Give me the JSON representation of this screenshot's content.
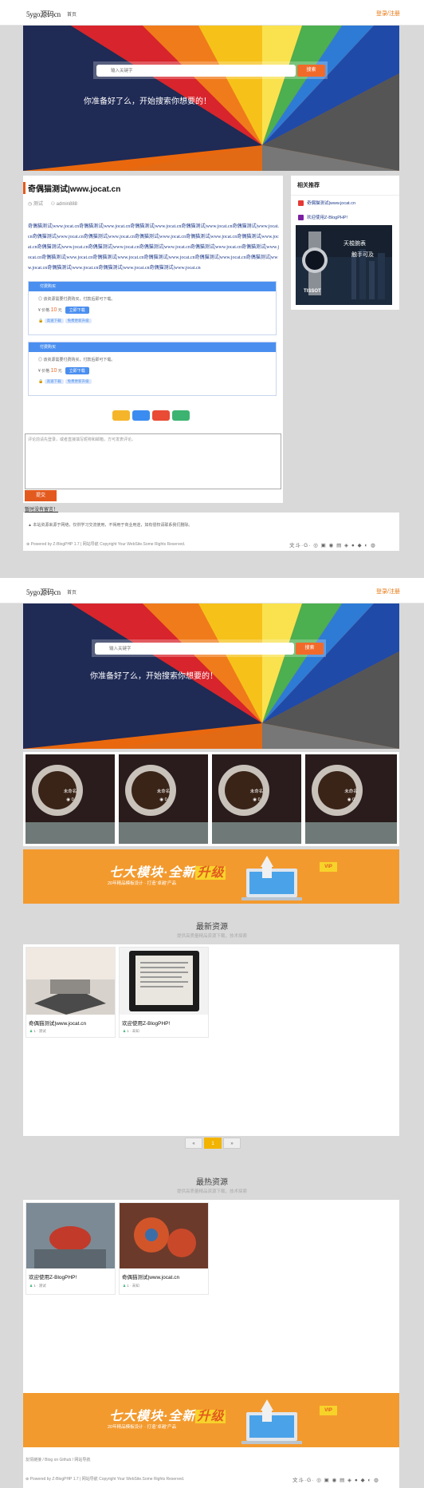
{
  "header": {
    "logo": "5ygo源码cn",
    "nav_label": "首页",
    "login_label": "登录/注册"
  },
  "hero": {
    "search_placeholder": "输入关键字",
    "search_button": "搜索",
    "slogan": "你准备好了么，开始搜索你想要的！"
  },
  "article": {
    "title": "奇偶猫测试|www.jocat.cn",
    "category": "测试",
    "author": "admin888",
    "body": "奇偶猫测试|www.jocat.cn奇偶猫测试|www.jocat.cn奇偶猫测试|www.jocat.cn奇偶猫测试|www.jocat.cn奇偶猫测试|www.jocat.cn奇偶猫测试|www.jocat.cn奇偶猫测试|www.jocat.cn奇偶猫测试|www.jocat.cn奇偶猫测试|www.jocat.cn奇偶猫测试|www.jocat.cn奇偶猫测试|www.jocat.cn奇偶猫测试|www.jocat.cn奇偶猫测试|www.jocat.cn奇偶猫测试|www.jocat.cn奇偶猫测试|www.jocat.cn奇偶猫测试|www.jocat.cn奇偶猫测试|www.jocat.cn奇偶猫测试|www.jocat.cn奇偶猫测试|www.jocat.cn奇偶猫测试|www.jocat.cn奇偶猫测试|www.jocat.cn奇偶猫测试|www.jocat.cn奇偶猫测试|www.jocat.cn",
    "download_boxes": [
      {
        "header": "付费购买",
        "desc": "该资源需要付费购买，付款后即可下载。",
        "price_label": "价格",
        "price": "10",
        "unit": "元",
        "buy": "立即下载",
        "tags": [
          "高速下载",
          "免费更新升级"
        ]
      },
      {
        "header": "付费购买",
        "desc": "该资源需要付费购买，付款后即可下载。",
        "price_label": "价格",
        "price": "10",
        "unit": "元",
        "buy": "立即下载",
        "tags": [
          "高速下载",
          "免费更新升级"
        ]
      }
    ],
    "comment_placeholder": "评论前请先登录，或者直接填写昵称和邮箱，方可发表评论。",
    "submit_label": "提交",
    "comment_heading": "暂时没有留言！"
  },
  "sidebar": {
    "heading": "相关推荐",
    "items": [
      {
        "label": "奇偶猫测试|www.jocat.cn",
        "color": "#e53935"
      },
      {
        "label": "欢迎使用Z-BlogPHP!",
        "color": "#7b1fa2"
      }
    ],
    "ad": {
      "line1": "天梭腕表",
      "line2": "触手可及",
      "brand": "TISSOT"
    }
  },
  "footer": {
    "note": "本站资源来源于网络，仅供学习交流使用，不得用于商业用途，如有侵权请联系我们删除。",
    "powered": "Powered by Z-BlogPHP 1.7 | 网站导航 Copyright Your WebSite.Some Rights Reserved.",
    "icons": "文斗·G·"
  },
  "second_page": {
    "tiles": [
      {
        "title": "未命名",
        "views": "0"
      },
      {
        "title": "未命名",
        "views": "0"
      },
      {
        "title": "未命名",
        "views": "0"
      },
      {
        "title": "未命名",
        "views": "0"
      }
    ],
    "banner": {
      "main": "七大模块·全新",
      "highlight": "升级",
      "sub": "20年精品模板设计 · 打造“卓越”产品",
      "vip": "VIP"
    },
    "latest": {
      "title": "最新资源",
      "subtitle": "提供高质量精品资源下载，技术探索",
      "cards": [
        {
          "title": "奇偶猫测试|www.jocat.cn",
          "meta": "1  · 测试"
        },
        {
          "title": "欢迎使用Z-BlogPHP!",
          "meta": "1  · 未知"
        }
      ]
    },
    "pager": {
      "prev": "«",
      "current": "1",
      "next": "»"
    },
    "hot": {
      "title": "最热资源",
      "subtitle": "提供高质量精品资源下载，技术探索",
      "cards": [
        {
          "title": "欢迎使用Z-BlogPHP!",
          "meta": "1  · 测试"
        },
        {
          "title": "奇偶猫测试|www.jocat.cn",
          "meta": "1  · 未知"
        }
      ]
    },
    "footer_links": "友情链接 / Blog on Github / 网站导航",
    "powered": "Powered by Z-BlogPHP 1.7 | 网站导航 Copyright Your WebSite.Some Rights Reserved."
  }
}
